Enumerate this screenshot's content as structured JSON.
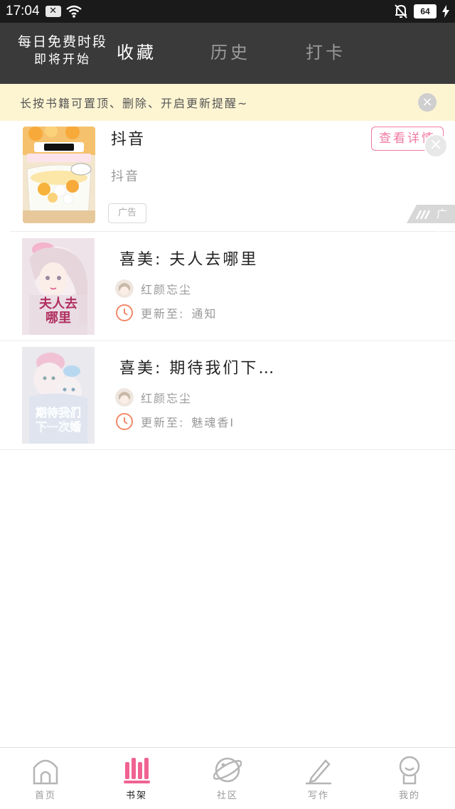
{
  "status_bar": {
    "time": "17:04",
    "battery": "64"
  },
  "header": {
    "promo_line1": "每日免费时段",
    "promo_line2": "即将开始",
    "tabs": [
      {
        "label": "收藏",
        "active": true
      },
      {
        "label": "历史",
        "active": false
      },
      {
        "label": "打卡",
        "active": false
      }
    ]
  },
  "notice": {
    "text": "长按书籍可置顶、删除、开启更新提醒~"
  },
  "ad": {
    "title": "抖音",
    "subtitle": "抖音",
    "tag": "广告",
    "detail_button": "查看详情",
    "badge": "广告"
  },
  "books": [
    {
      "title": "喜美: 夫人去哪里",
      "author": "红颜忘尘",
      "update_label": "更新至:",
      "update_value": "通知"
    },
    {
      "title": "喜美: 期待我们下…",
      "author": "红颜忘尘",
      "update_label": "更新至:",
      "update_value": "魅魂香I"
    }
  ],
  "bottom_nav": [
    {
      "label": "首页",
      "icon": "home-icon",
      "active": false
    },
    {
      "label": "书架",
      "icon": "bookshelf-icon",
      "active": true
    },
    {
      "label": "社区",
      "icon": "planet-icon",
      "active": false
    },
    {
      "label": "写作",
      "icon": "pen-icon",
      "active": false
    },
    {
      "label": "我的",
      "icon": "profile-icon",
      "active": false
    }
  ],
  "colors": {
    "accent": "#f06292",
    "header_bg": "#3a3a3a",
    "notice_bg": "#fdf5d2"
  }
}
